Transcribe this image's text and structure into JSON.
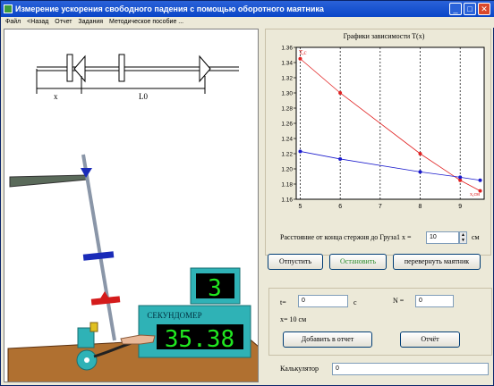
{
  "window": {
    "title": "Измерение ускорения свободного падения с помощью оборотного маятника"
  },
  "menu": [
    "Файл",
    "<Назад",
    "Отчет",
    "Задания",
    "Методическое пособие ..."
  ],
  "schematic": {
    "x_label": "x",
    "l0_label": "L0"
  },
  "stopwatch": {
    "count": "3",
    "label": "СЕКУНДОМЕР",
    "time": "35.38"
  },
  "chart_data": {
    "type": "line",
    "title": "Графики зависимости T(x)",
    "ylabel": "T,c",
    "xlabel": "x,cм",
    "xlim": [
      4.9,
      9.6
    ],
    "ylim": [
      1.16,
      1.36
    ],
    "xticks": [
      5,
      6,
      7,
      8,
      9
    ],
    "yticks": [
      1.16,
      1.18,
      1.2,
      1.22,
      1.24,
      1.26,
      1.28,
      1.3,
      1.32,
      1.34,
      1.36
    ],
    "grid": true,
    "series": [
      {
        "color": "#e02020",
        "x": [
          5,
          6,
          8,
          9,
          9.5
        ],
        "y": [
          1.345,
          1.3,
          1.22,
          1.185,
          1.171
        ]
      },
      {
        "color": "#1a1acc",
        "x": [
          5,
          6,
          8,
          9,
          9.5
        ],
        "y": [
          1.223,
          1.213,
          1.196,
          1.189,
          1.185
        ]
      }
    ]
  },
  "controls": {
    "distance_label": "Расстояние от конца стержня до Груза1 x =",
    "distance_value": "10",
    "distance_unit": "см",
    "btn_release": "Отпустить",
    "btn_stop": "Остановить",
    "btn_flip": "перевернуть маятник",
    "t_label": "t=",
    "t_value": "0",
    "t_unit": "c",
    "n_label": "N =",
    "n_value": "0",
    "x_info": "x=  10 см",
    "btn_add_report": "Добавить в отчет",
    "btn_report": "Отчёт",
    "calc_label": "Калькулятор",
    "calc_value": "0"
  },
  "colors": {
    "chart_bg": "#ffffff",
    "panel": "#ece9d8",
    "stopwatch_body": "#2fb2b6",
    "digits": "#20e820"
  }
}
